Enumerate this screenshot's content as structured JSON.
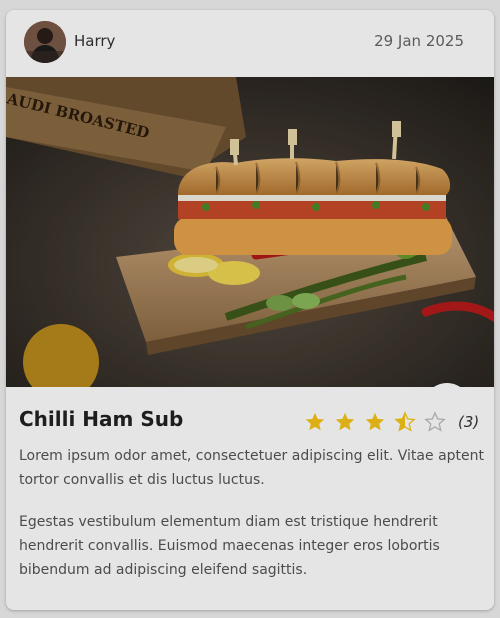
{
  "post": {
    "author": "Harry",
    "date": "29 Jan 2025"
  },
  "recipe": {
    "title": "Chilli Ham Sub",
    "rating": 3.5,
    "rating_max": 5,
    "rating_count": "(3)",
    "description": [
      "Lorem ipsum odor amet, consectetuer adipiscing elit. Vitae aptent tortor convallis et dis luctus luctus.",
      "Egestas vestibulum elementum diam est tristique hendrerit hendrerit convallis. Euismod maecenas integer eros lobortis bibendum ad adipiscing eleifend sagittis."
    ]
  },
  "photo_text": "AUDI BROASTED",
  "favorite": {
    "icon": "heart-outline-icon",
    "color": "#e53935"
  },
  "colors": {
    "star": "#f5c518",
    "star_empty": "#bbbbbb",
    "accent": "#e53935"
  }
}
